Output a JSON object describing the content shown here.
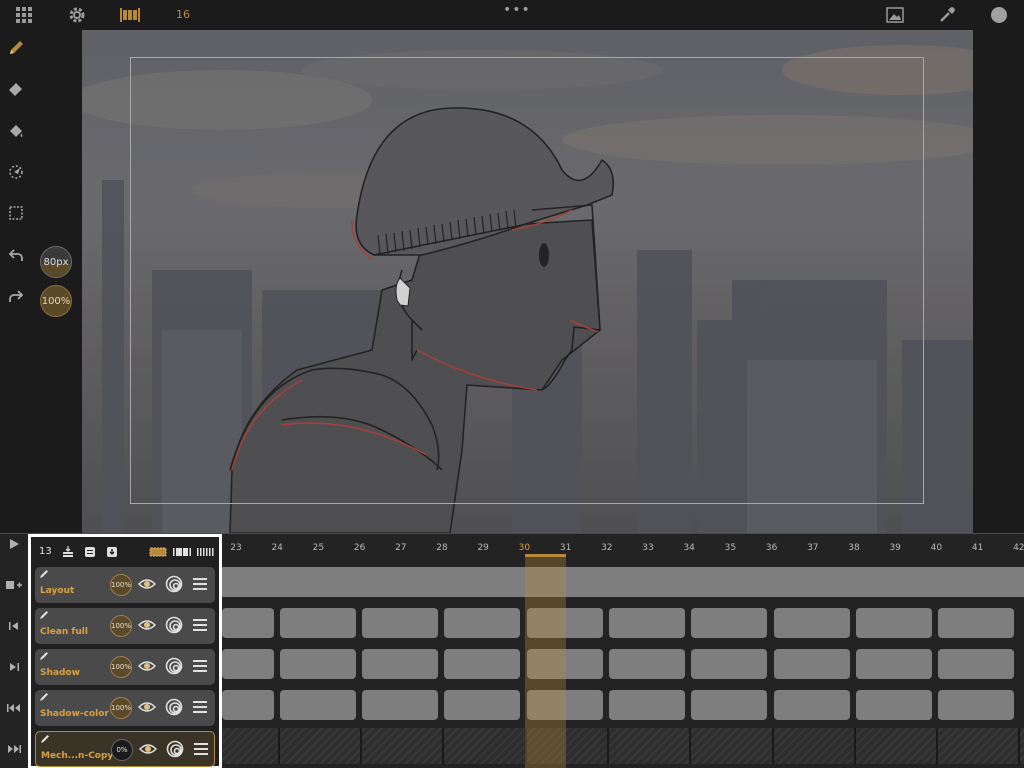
{
  "toolbar": {
    "current_frame": "16",
    "more_icon": "three-dots"
  },
  "brush": {
    "size": "80px",
    "size_fill": 0.45,
    "opacity": "100%"
  },
  "timeline": {
    "layer_count": "13",
    "frame_numbers": [
      "23",
      "24",
      "25",
      "26",
      "27",
      "28",
      "29",
      "30",
      "31",
      "32",
      "33",
      "34",
      "35",
      "36",
      "37",
      "38",
      "39",
      "40",
      "41",
      "42"
    ],
    "current_frame": "30",
    "layers": [
      {
        "name": "Layout",
        "opacity": "100%"
      },
      {
        "name": "Clean full",
        "opacity": "100%"
      },
      {
        "name": "Shadow",
        "opacity": "100%"
      },
      {
        "name": "Shadow-color",
        "opacity": "100%"
      },
      {
        "name": "Mech...n-Copy",
        "opacity": "0%"
      }
    ]
  },
  "colors": {
    "accent": "#b8893a",
    "layer_name": "#d9a13f",
    "panel_border": "#ffffff"
  }
}
